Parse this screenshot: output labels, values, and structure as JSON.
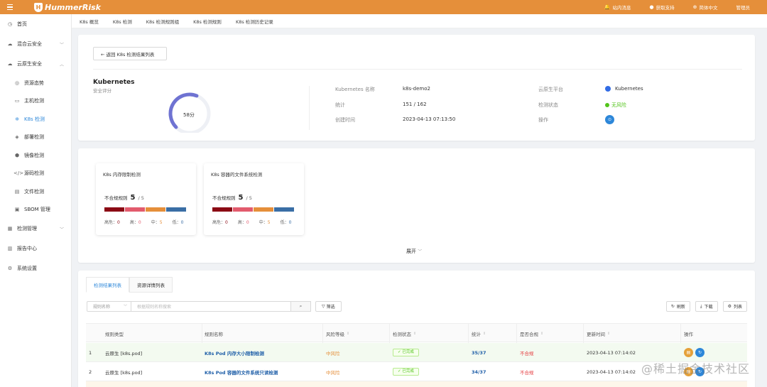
{
  "topbar": {
    "logo": "HummerRisk",
    "items": [
      {
        "icon": "bell-icon",
        "label": "站内消息"
      },
      {
        "icon": "help-icon",
        "label": "获取支持"
      },
      {
        "icon": "globe-icon",
        "label": "简体中文"
      },
      {
        "icon": "user-icon",
        "label": "管理员"
      }
    ]
  },
  "sidebar": {
    "items": [
      {
        "label": "首页",
        "icon": "home-icon"
      },
      {
        "label": "混合云安全",
        "icon": "cloud-icon",
        "chevron": "﹀"
      },
      {
        "label": "云原生安全",
        "icon": "cloud-native-icon",
        "chevron": "︿"
      },
      {
        "label": "资源态势",
        "icon": "dashboard-icon"
      },
      {
        "label": "主机检测",
        "icon": "server-icon"
      },
      {
        "label": "K8s 检测",
        "icon": "k8s-icon"
      },
      {
        "label": "部署检测",
        "icon": "deploy-icon"
      },
      {
        "label": "镜像检测",
        "icon": "image-icon"
      },
      {
        "label": "源码检测",
        "icon": "code-icon"
      },
      {
        "label": "文件检测",
        "icon": "file-icon"
      },
      {
        "label": "SBOM 管理",
        "icon": "sbom-icon"
      },
      {
        "label": "检测管理",
        "icon": "manage-icon",
        "chevron": "﹀"
      },
      {
        "label": "报告中心",
        "icon": "report-icon"
      },
      {
        "label": "系统设置",
        "icon": "settings-icon"
      }
    ]
  },
  "tabs": [
    "K8s 概览",
    "K8s 检测",
    "K8s 检测规则组",
    "K8s 检测规则",
    "K8s 检测历史记录"
  ],
  "summary": {
    "back_label": "← 返回 K8s 检测结果列表",
    "title": "Kubernetes",
    "subtitle": "安全评分",
    "score": 58,
    "score_label": "58分",
    "fields": {
      "name_label": "Kubernetes 名称",
      "name_value": "k8s-demo2",
      "stat_label": "统计",
      "stat_value": "151 / 162",
      "created_label": "创建时间",
      "created_value": "2023-04-13 07:13:50",
      "platform_label": "云原生平台",
      "platform_value": "Kubernetes",
      "status_label": "检测状态",
      "status_value": "无风险",
      "action_label": "操作"
    }
  },
  "rule_groups": [
    {
      "title": "K8s 内存限制检测",
      "count_label": "不合规规则",
      "count": "5",
      "total": "/ 5",
      "levels": [
        {
          "label": "高危",
          "value": "0"
        },
        {
          "label": "高",
          "value": "0"
        },
        {
          "label": "中",
          "value": "5"
        },
        {
          "label": "低",
          "value": "0"
        }
      ]
    },
    {
      "title": "K8s 容器的文件系统检测",
      "count_label": "不合规规则",
      "count": "5",
      "total": "/ 5",
      "levels": [
        {
          "label": "高危",
          "value": "0"
        },
        {
          "label": "高",
          "value": "0"
        },
        {
          "label": "中",
          "value": "5"
        },
        {
          "label": "低",
          "value": "0"
        }
      ]
    }
  ],
  "level_colors": [
    "#8b0a14",
    "#e25b6d",
    "#e58f3a",
    "#3a6ea5"
  ],
  "expand_label": "展开",
  "results": {
    "tabs": [
      "检测结果列表",
      "资源详情列表"
    ],
    "filter_select": "规则名称",
    "search_placeholder": "根据规则名称搜索",
    "filter_btn": "筛选",
    "tools": [
      "刷新",
      "下载",
      "列表"
    ],
    "columns": [
      "规则类型",
      "规则名称",
      "风险等级",
      "检测状态",
      "统计",
      "是否合规",
      "更新时间",
      "操作"
    ],
    "rows": [
      {
        "index": "1",
        "type": "云原生 [k8s.pod]",
        "name": "K8s Pod 内存大小限制检测",
        "risk": "中风险",
        "status": "已完成",
        "stat": "35/37",
        "compliant": "不合规",
        "updated": "2023-04-13 07:14:02"
      },
      {
        "index": "2",
        "type": "云原生 [k8s.pod]",
        "name": "K8s Pod 容器的文件系统只读检测",
        "risk": "中风险",
        "status": "已完成",
        "stat": "34/37",
        "compliant": "不合规",
        "updated": "2023-04-13 07:14:02"
      }
    ]
  },
  "watermark": "@稀土掘金技术社区"
}
